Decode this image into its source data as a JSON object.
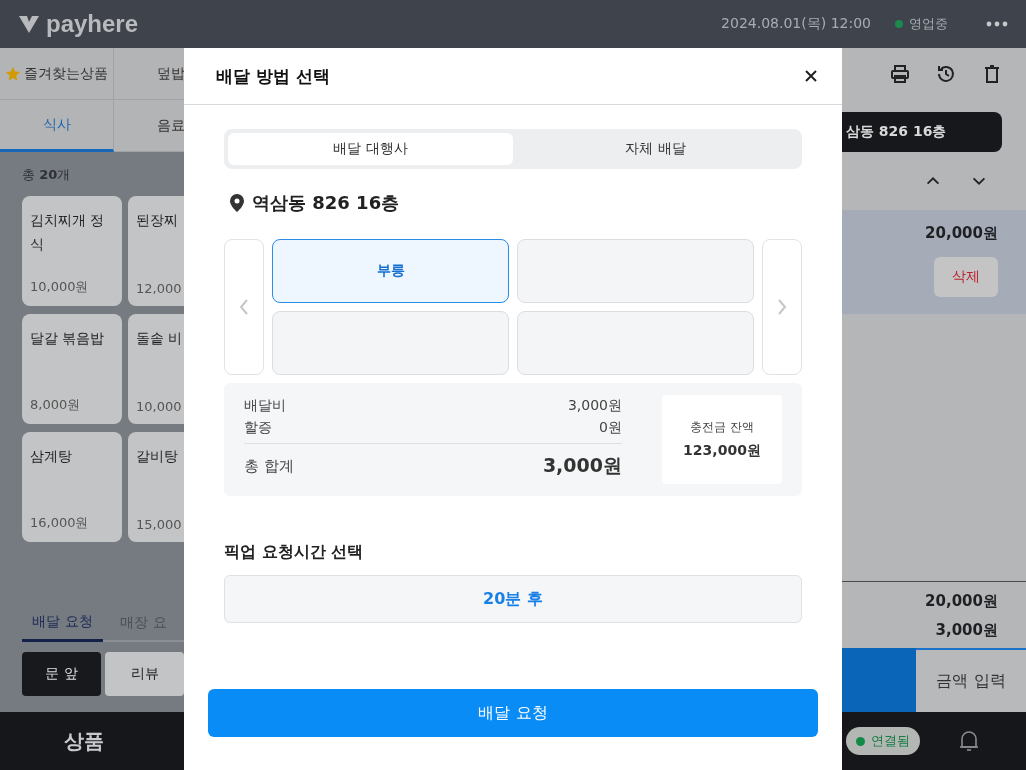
{
  "header": {
    "logo": "payhere",
    "datetime": "2024.08.01(목) 12:00",
    "status": "영업중"
  },
  "category_tabs": [
    {
      "label": "즐겨찾는상품",
      "kind": "favorite",
      "selected": false
    },
    {
      "label": "덮밥",
      "kind": "plain",
      "selected": false
    },
    {
      "label": "식사",
      "kind": "plain",
      "selected": true
    },
    {
      "label": "음료",
      "kind": "plain",
      "selected": false
    }
  ],
  "product_count": "총 **20**개",
  "products": [
    {
      "name": "김치찌개 정식",
      "price": "10,000원"
    },
    {
      "name": "된장찌",
      "price": "12,000"
    },
    {
      "name": "달갈 볶음밥",
      "price": "8,000원"
    },
    {
      "name": "돌솥 비",
      "price": "10,000"
    },
    {
      "name": "삼계탕",
      "price": "16,000원"
    },
    {
      "name": "갈비탕",
      "price": "15,000"
    }
  ],
  "request_tabs": [
    {
      "label": "배달 요청",
      "selected": true
    },
    {
      "label": "매장 요",
      "selected": false
    }
  ],
  "request_chips": [
    {
      "label": "문 앞",
      "selected": true
    },
    {
      "label": "리뷰",
      "selected": false
    }
  ],
  "bottom_nav": {
    "label": "상품"
  },
  "order_panel": {
    "address": "삼동 826 16층",
    "row": {
      "price": "20,000원",
      "delete_label": "삭제",
      "selected": true
    },
    "totals": [
      "20,000원",
      "3,000원"
    ],
    "amount_button": "금액 입력",
    "connection": "연결됨"
  },
  "modal": {
    "title": "배달 방법 선택",
    "tabs": [
      {
        "label": "배달 대행사",
        "selected": true
      },
      {
        "label": "자체 배달",
        "selected": false
      }
    ],
    "location": "역삼동 826 16층",
    "providers": [
      {
        "label": "부릉",
        "selected": true
      },
      {
        "selected": false
      },
      {
        "selected": false
      },
      {
        "selected": false
      }
    ],
    "fees": [
      {
        "label": "배달비",
        "value": "3,000원"
      },
      {
        "label": "할증",
        "value": "0원"
      }
    ],
    "total": {
      "label": "총 합계",
      "value": "3,000원"
    },
    "balance": {
      "label": "충전금 잔액",
      "value": "123,000원"
    },
    "pickup": {
      "label": "픽업 요청시간 선택",
      "value": "20분 후"
    },
    "submit": "배달 요청"
  }
}
